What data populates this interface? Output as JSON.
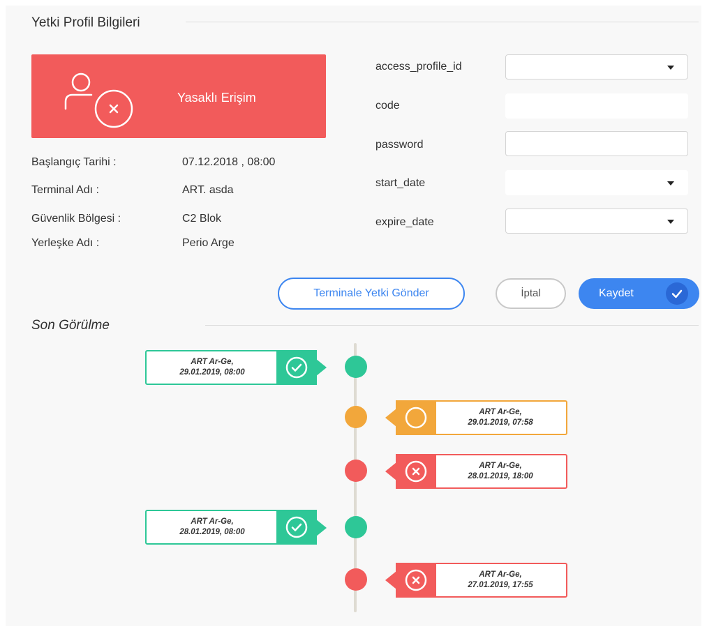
{
  "section": {
    "title": "Yetki Profil Bilgileri"
  },
  "status": {
    "label": "Yasaklı Erişim",
    "icon": "user-blocked-icon",
    "color": "#f25b5b"
  },
  "info": [
    {
      "label": "Başlangıç Tarihi :",
      "value": "07.12.2018 , 08:00"
    },
    {
      "label": "Terminal Adı :",
      "value": "ART. asda"
    },
    {
      "label": "Güvenlik Bölgesi :",
      "value": "C2 Blok"
    },
    {
      "label": "Yerleşke Adı :",
      "value": "Perio Arge"
    }
  ],
  "form": {
    "access_profile_id": {
      "label": "access_profile_id",
      "value": ""
    },
    "code": {
      "label": "code",
      "value": ""
    },
    "password": {
      "label": "password",
      "value": ""
    },
    "start_date": {
      "label": "start_date",
      "value": ""
    },
    "expire_date": {
      "label": "expire_date",
      "value": ""
    }
  },
  "buttons": {
    "send": "Terminale Yetki Gönder",
    "cancel": "İptal",
    "save": "Kaydet"
  },
  "last_seen": {
    "title": "Son Görülme",
    "events": [
      {
        "line1": "ART Ar-Ge,",
        "line2": "29.01.2019, 08:00",
        "status": "granted",
        "side": "left",
        "icon": "check-circle-icon"
      },
      {
        "line1": "ART Ar-Ge,",
        "line2": "29.01.2019, 07:58",
        "status": "pending",
        "side": "right",
        "icon": "circle-icon"
      },
      {
        "line1": "ART Ar-Ge,",
        "line2": "28.01.2019, 18:00",
        "status": "denied",
        "side": "right",
        "icon": "x-circle-icon"
      },
      {
        "line1": "ART Ar-Ge,",
        "line2": "28.01.2019, 08:00",
        "status": "granted",
        "side": "left",
        "icon": "check-circle-icon"
      },
      {
        "line1": "ART Ar-Ge,",
        "line2": "27.01.2019, 17:55",
        "status": "denied",
        "side": "right",
        "icon": "x-circle-icon"
      }
    ]
  },
  "colors": {
    "granted": "#2ec797",
    "pending": "#f2a73b",
    "denied": "#f25b5b",
    "accent": "#3d86f0"
  }
}
